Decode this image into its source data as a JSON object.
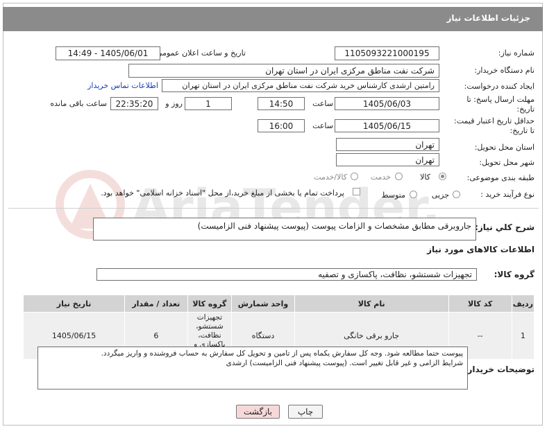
{
  "header": {
    "title": "جزئیات اطلاعات نیاز"
  },
  "need_number": {
    "label": "شماره نیاز:",
    "value": "1105093221000195"
  },
  "announce": {
    "label": "تاریخ و ساعت اعلان عمومی:",
    "value": "1405/06/01 - 14:49"
  },
  "buyer_org": {
    "label": "نام دستگاه خریدار:",
    "value": "شرکت نفت مناطق مرکزی ایران در استان تهران"
  },
  "creator": {
    "label": "ایجاد کننده درخواست:",
    "value": "رامتین ارشدی کارشناس خرید شرکت نفت مناطق مرکزی ایران در استان تهران",
    "contact_link": "اطلاعات تماس خریدار"
  },
  "deadline": {
    "label_line1": "مهلت ارسال پاسخ: تا",
    "label_line2": "تاریخ:",
    "date": "1405/06/03",
    "time_label": "ساعت",
    "time": "14:50",
    "days": "1",
    "days_label": "روز و",
    "remaining": "22:35:20",
    "remaining_label": "ساعت باقی مانده"
  },
  "validity": {
    "label_line1": "حداقل تاریخ اعتبار قیمت:",
    "label_line2": "تا تاریخ:",
    "date": "1405/06/15",
    "time_label": "ساعت",
    "time": "16:00"
  },
  "province": {
    "label": "استان محل تحویل:",
    "value": "تهران"
  },
  "city": {
    "label": "شهر محل تحویل:",
    "value": "تهران"
  },
  "category": {
    "label": "طبقه بندی موضوعی:",
    "options": [
      "کالا",
      "خدمت",
      "کالا/خدمت"
    ],
    "selected": "کالا"
  },
  "process": {
    "label": "نوع فرآیند خرید :",
    "options": [
      "جزیی",
      "متوسط"
    ],
    "payment_note": "پرداخت تمام یا بخشی از مبلغ خرید،از محل \"اسناد خزانه اسلامی\" خواهد بود."
  },
  "summary": {
    "label": "شرح کلي نياز:",
    "value": "جاروبرقی مطابق مشخصات و الزامات پیوست (پیوست پیشنهاد فنی الزامیست)"
  },
  "goods_info": {
    "title": "اطلاعات کالاهای مورد نیاز"
  },
  "goods_group": {
    "label": "گروه کالا:",
    "value": "تجهیزات شستشو، نظافت، پاکسازی و تصفیه"
  },
  "table": {
    "headers": [
      "ردیف",
      "کد کالا",
      "نام کالا",
      "واحد شمارش",
      "گروه کالا",
      "تعداد / مقدار",
      "تاریخ نیاز"
    ],
    "rows": [
      [
        "1",
        "--",
        "جارو برقی خانگی",
        "دستگاه",
        "تجهیزات شستشو، نظافت، پاکسازی و تصفیه",
        "6",
        "1405/06/15"
      ]
    ]
  },
  "buyer_notes": {
    "label": "توضیحات خریدار:",
    "line1": "پیوست حتما مطالعه شود. وجه کل سفارش یکماه پس از تامین و تحویل کل سفارش به حساب فروشنده و واریز میگردد.",
    "line2": "شرایط الزامی و غیر قابل تغییر است. (پیوست پیشنهاد فنی الزامیست) ارشدی"
  },
  "buttons": {
    "print": "چاپ",
    "back": "بازگشت"
  },
  "watermark": {
    "text": "AriaTender.net"
  },
  "colors": {
    "header_bg": "#8b8b8b",
    "link": "#1a3cb8",
    "back_button_bg": "#f7d8d8"
  }
}
